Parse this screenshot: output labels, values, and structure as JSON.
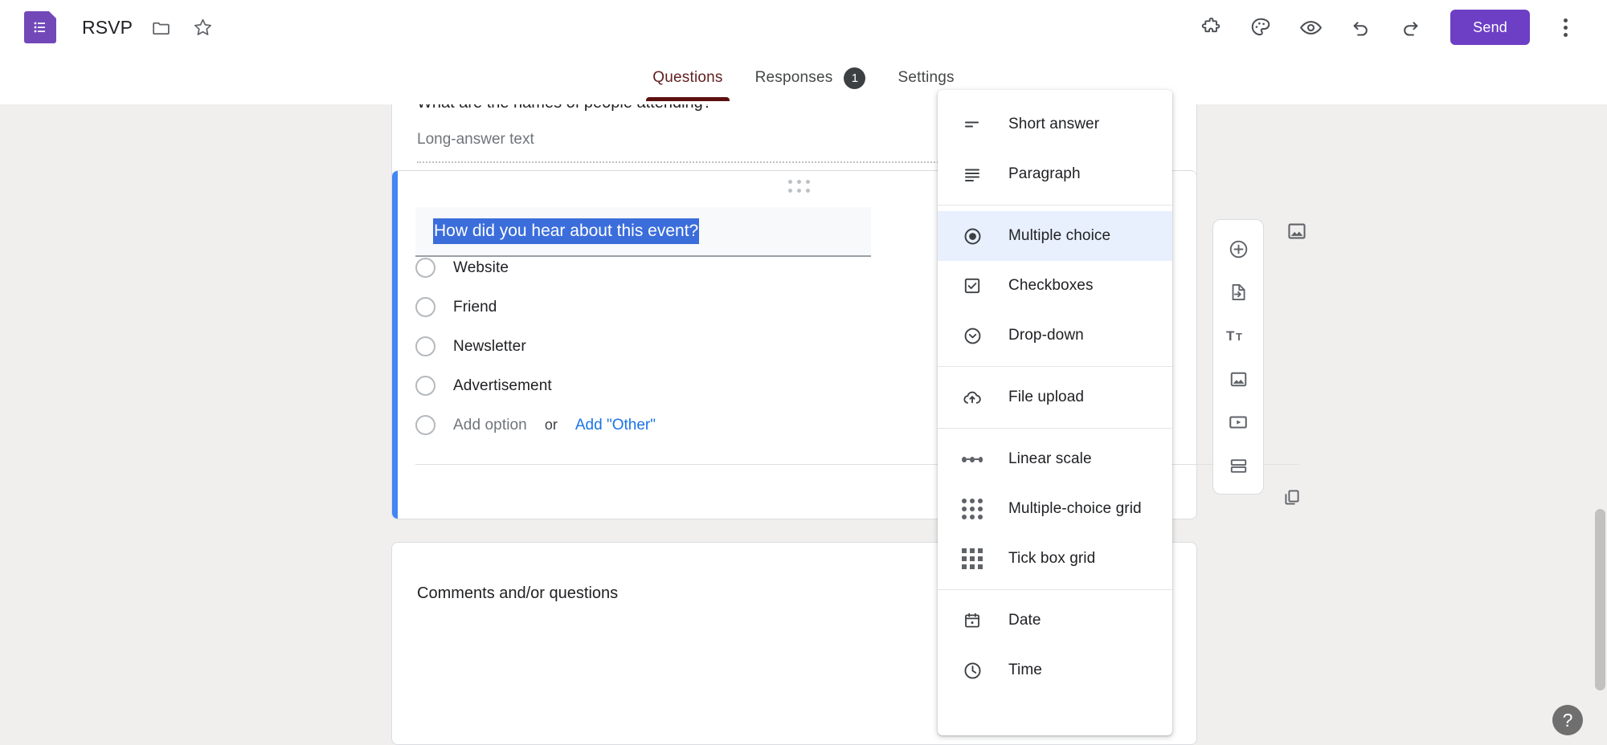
{
  "header": {
    "logo_icon": "google-forms-logo",
    "doc_title": "RSVP",
    "folder_icon": "folder-icon",
    "star_icon": "star-icon",
    "tools": [
      {
        "name": "addons-icon",
        "label": "Add-ons"
      },
      {
        "name": "palette-icon",
        "label": "Customise theme"
      },
      {
        "name": "eye-icon",
        "label": "Preview"
      },
      {
        "name": "undo-icon",
        "label": "Undo"
      },
      {
        "name": "redo-icon",
        "label": "Redo"
      }
    ],
    "send_label": "Send",
    "more_icon": "kebab-menu-icon",
    "brand_purple": "#6c3fc5"
  },
  "tabs": [
    {
      "label": "Questions",
      "active": true,
      "badge": null
    },
    {
      "label": "Responses",
      "active": false,
      "badge": "1"
    },
    {
      "label": "Settings",
      "active": false,
      "badge": null
    }
  ],
  "tab_accent": "#5c1010",
  "cards": {
    "top": {
      "question_title": "What are the names of people attending?",
      "answer_placeholder": "Long-answer text"
    },
    "active": {
      "question_title": "How did you hear about this event?",
      "title_selected": true,
      "selection_color": "#3b6ddb",
      "active_bar_color": "#4285f4",
      "image_button": "insert-image-icon",
      "drag_handle": "drag-handle-icon",
      "duplicate_button": "duplicate-icon",
      "options": [
        {
          "label": "Website"
        },
        {
          "label": "Friend"
        },
        {
          "label": "Newsletter"
        },
        {
          "label": "Advertisement"
        }
      ],
      "add_option_label": "Add option",
      "or_label": "or",
      "add_other_label": "Add \"Other\"",
      "add_other_color": "#1a73e8"
    },
    "bottom": {
      "question_title": "Comments and/or questions"
    }
  },
  "side_toolbar": [
    {
      "name": "add-question-icon",
      "label": "Add question"
    },
    {
      "name": "import-questions-icon",
      "label": "Import questions"
    },
    {
      "name": "add-title-description-icon",
      "label": "Add title and description"
    },
    {
      "name": "add-image-icon",
      "label": "Add image"
    },
    {
      "name": "add-video-icon",
      "label": "Add video"
    },
    {
      "name": "add-section-icon",
      "label": "Add section"
    }
  ],
  "dropdown": {
    "selected": "Multiple choice",
    "highlight_color": "#e8f0fe",
    "groups": [
      {
        "items": [
          {
            "label": "Short answer",
            "icon": "short-answer-icon"
          },
          {
            "label": "Paragraph",
            "icon": "paragraph-icon"
          }
        ]
      },
      {
        "items": [
          {
            "label": "Multiple choice",
            "icon": "radio-button-icon"
          },
          {
            "label": "Checkboxes",
            "icon": "checkbox-icon"
          },
          {
            "label": "Drop-down",
            "icon": "chevron-down-circle-icon"
          }
        ]
      },
      {
        "items": [
          {
            "label": "File upload",
            "icon": "cloud-upload-icon"
          }
        ]
      },
      {
        "items": [
          {
            "label": "Linear scale",
            "icon": "linear-scale-icon"
          },
          {
            "label": "Multiple-choice grid",
            "icon": "radio-grid-icon"
          },
          {
            "label": "Tick box grid",
            "icon": "checkbox-grid-icon"
          }
        ]
      },
      {
        "items": [
          {
            "label": "Date",
            "icon": "calendar-icon"
          },
          {
            "label": "Time",
            "icon": "clock-icon"
          }
        ]
      }
    ]
  },
  "help": {
    "label": "?"
  }
}
